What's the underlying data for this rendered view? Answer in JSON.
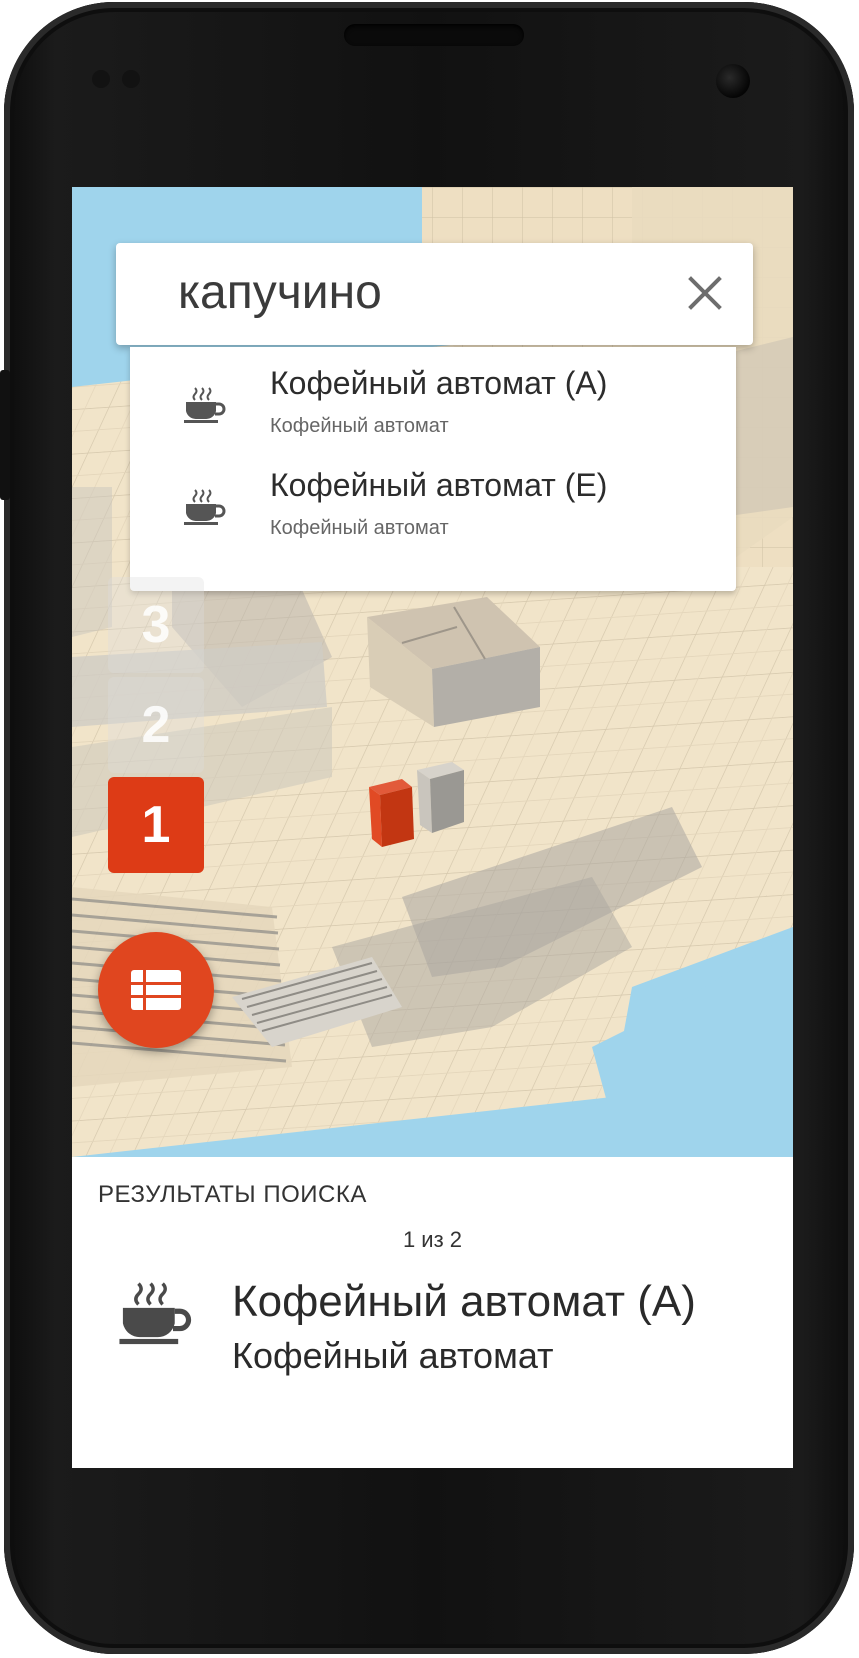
{
  "search": {
    "query": "капучино"
  },
  "suggestions": [
    {
      "title": "Кофейный автомат (A)",
      "subtitle": "Кофейный автомат",
      "icon": "coffee-cup-icon"
    },
    {
      "title": "Кофейный автомат (E)",
      "subtitle": "Кофейный автомат",
      "icon": "coffee-cup-icon"
    }
  ],
  "floors": [
    "3",
    "2",
    "1"
  ],
  "active_floor": "1",
  "fab": {
    "icon": "list-icon"
  },
  "results": {
    "header": "РЕЗУЛЬТАТЫ ПОИСКА",
    "count": "1 из 2",
    "item": {
      "title": "Кофейный автомат (A)",
      "subtitle": "Кофейный автомат",
      "icon": "coffee-cup-icon"
    }
  },
  "colors": {
    "accent": "#dd3b16",
    "fab": "#e0461f",
    "map_floor": "#f1e4c9",
    "water": "#9fd4ec"
  }
}
